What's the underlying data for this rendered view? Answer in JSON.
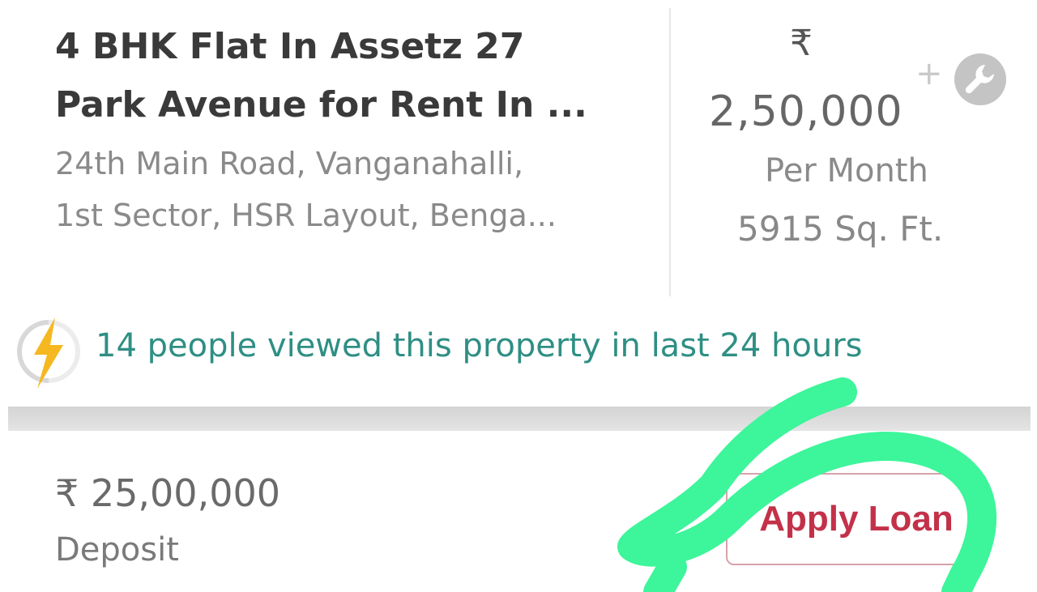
{
  "listing": {
    "title_line1": "4 BHK Flat In Assetz 27",
    "title_line2": "Park Avenue for Rent In ...",
    "address_line1": "24th Main Road, Vanganahalli,",
    "address_line2": "1st Sector, HSR Layout, Benga..."
  },
  "price": {
    "currency_symbol": "₹",
    "amount": "2,50,000",
    "period": "Per Month",
    "area": "5915 Sq. Ft."
  },
  "actions": {
    "plus": "+",
    "tool_icon": "wrench-icon"
  },
  "views": {
    "icon": "lightning-icon",
    "text": "14 people viewed this property in last 24 hours"
  },
  "deposit": {
    "amount": "₹ 25,00,000",
    "label": "Deposit"
  },
  "loan": {
    "button_label": "Apply Loan"
  },
  "colors": {
    "views_text": "#2f8f84",
    "loan_accent": "#c33149",
    "highlight_marker": "#3df59a",
    "lightning": "#f5b820"
  }
}
